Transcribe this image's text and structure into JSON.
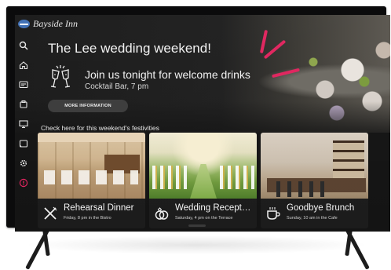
{
  "brand": {
    "name": "Bayside Inn",
    "icon": "hotel-logo-icon",
    "color": "#3f6fb5"
  },
  "nav": {
    "items": [
      {
        "name": "search",
        "icon": "search-icon"
      },
      {
        "name": "home",
        "icon": "home-icon"
      },
      {
        "name": "tv-guide",
        "icon": "tv-guide-icon"
      },
      {
        "name": "room-service",
        "icon": "room-service-icon"
      },
      {
        "name": "display",
        "icon": "monitor-icon"
      },
      {
        "name": "cast",
        "icon": "cast-icon"
      },
      {
        "name": "settings",
        "icon": "gear-icon"
      },
      {
        "name": "info",
        "icon": "info-alert-icon",
        "color": "#e0245e"
      }
    ]
  },
  "hero": {
    "title": "The Lee wedding weekend!",
    "headline": "Join us tonight for welcome drinks",
    "subtitle": "Cocktail Bar, 7 pm",
    "icon": "champagne-glasses-icon",
    "button_label": "MORE INFORMATION",
    "accent": "#e0245e"
  },
  "section": {
    "label": "Check here for this weekend's festivities"
  },
  "cards": [
    {
      "title": "Rehearsal Dinner",
      "subtitle": "Friday, 8 pm in the Bistro",
      "icon": "utensils-icon"
    },
    {
      "title": "Wedding Recept…",
      "subtitle": "Saturday, 4 pm on the Terrace",
      "icon": "wedding-rings-icon"
    },
    {
      "title": "Goodbye Brunch",
      "subtitle": "Sunday, 10 am in the Cafe",
      "icon": "coffee-cup-icon"
    }
  ]
}
